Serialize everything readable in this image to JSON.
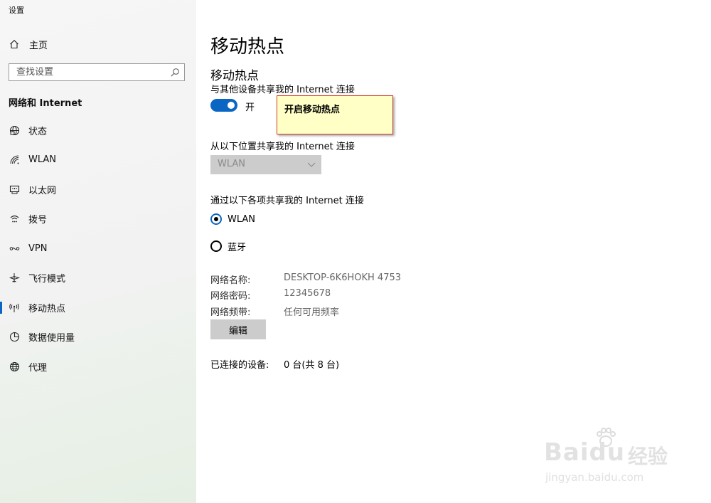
{
  "window": {
    "title": "设置"
  },
  "sidebar": {
    "home_label": "主页",
    "search_placeholder": "查找设置",
    "section_title": "网络和 Internet",
    "items": [
      {
        "label": "状态",
        "icon": "status-globe-icon"
      },
      {
        "label": "WLAN",
        "icon": "wifi-icon"
      },
      {
        "label": "以太网",
        "icon": "ethernet-icon"
      },
      {
        "label": "拨号",
        "icon": "dialup-icon"
      },
      {
        "label": "VPN",
        "icon": "vpn-icon"
      },
      {
        "label": "飞行模式",
        "icon": "airplane-icon"
      },
      {
        "label": "移动热点",
        "icon": "hotspot-icon",
        "selected": true
      },
      {
        "label": "数据使用量",
        "icon": "data-usage-icon"
      },
      {
        "label": "代理",
        "icon": "proxy-globe-icon"
      }
    ]
  },
  "main": {
    "page_title": "移动热点",
    "section_heading": "移动热点",
    "share_description": "与其他设备共享我的 Internet 连接",
    "toggle": {
      "state_label": "开",
      "on": true
    },
    "callout_text": "开启移动热点",
    "share_from_label": "从以下位置共享我的 Internet 连接",
    "share_from_value": "WLAN",
    "share_via_label": "通过以下各项共享我的 Internet 连接",
    "share_via_options": [
      {
        "label": "WLAN",
        "checked": true
      },
      {
        "label": "蓝牙",
        "checked": false
      }
    ],
    "properties": [
      {
        "key": "网络名称:",
        "value": "DESKTOP-6K6HOKH 4753"
      },
      {
        "key": "网络密码:",
        "value": "12345678"
      },
      {
        "key": "网络频带:",
        "value": "任何可用频率"
      }
    ],
    "edit_button_label": "编辑",
    "connected_devices_label": "已连接的设备:",
    "connected_devices_value": "0 台(共 8 台)"
  },
  "watermark": {
    "brand_text": "Bai",
    "brand_text_tail": "du",
    "brand_cn": "经验",
    "url": "jingyan.baidu.com"
  },
  "colors": {
    "accent": "#0a66c2",
    "callout_bg": "#ffffc6",
    "callout_border": "#d83a2a"
  }
}
